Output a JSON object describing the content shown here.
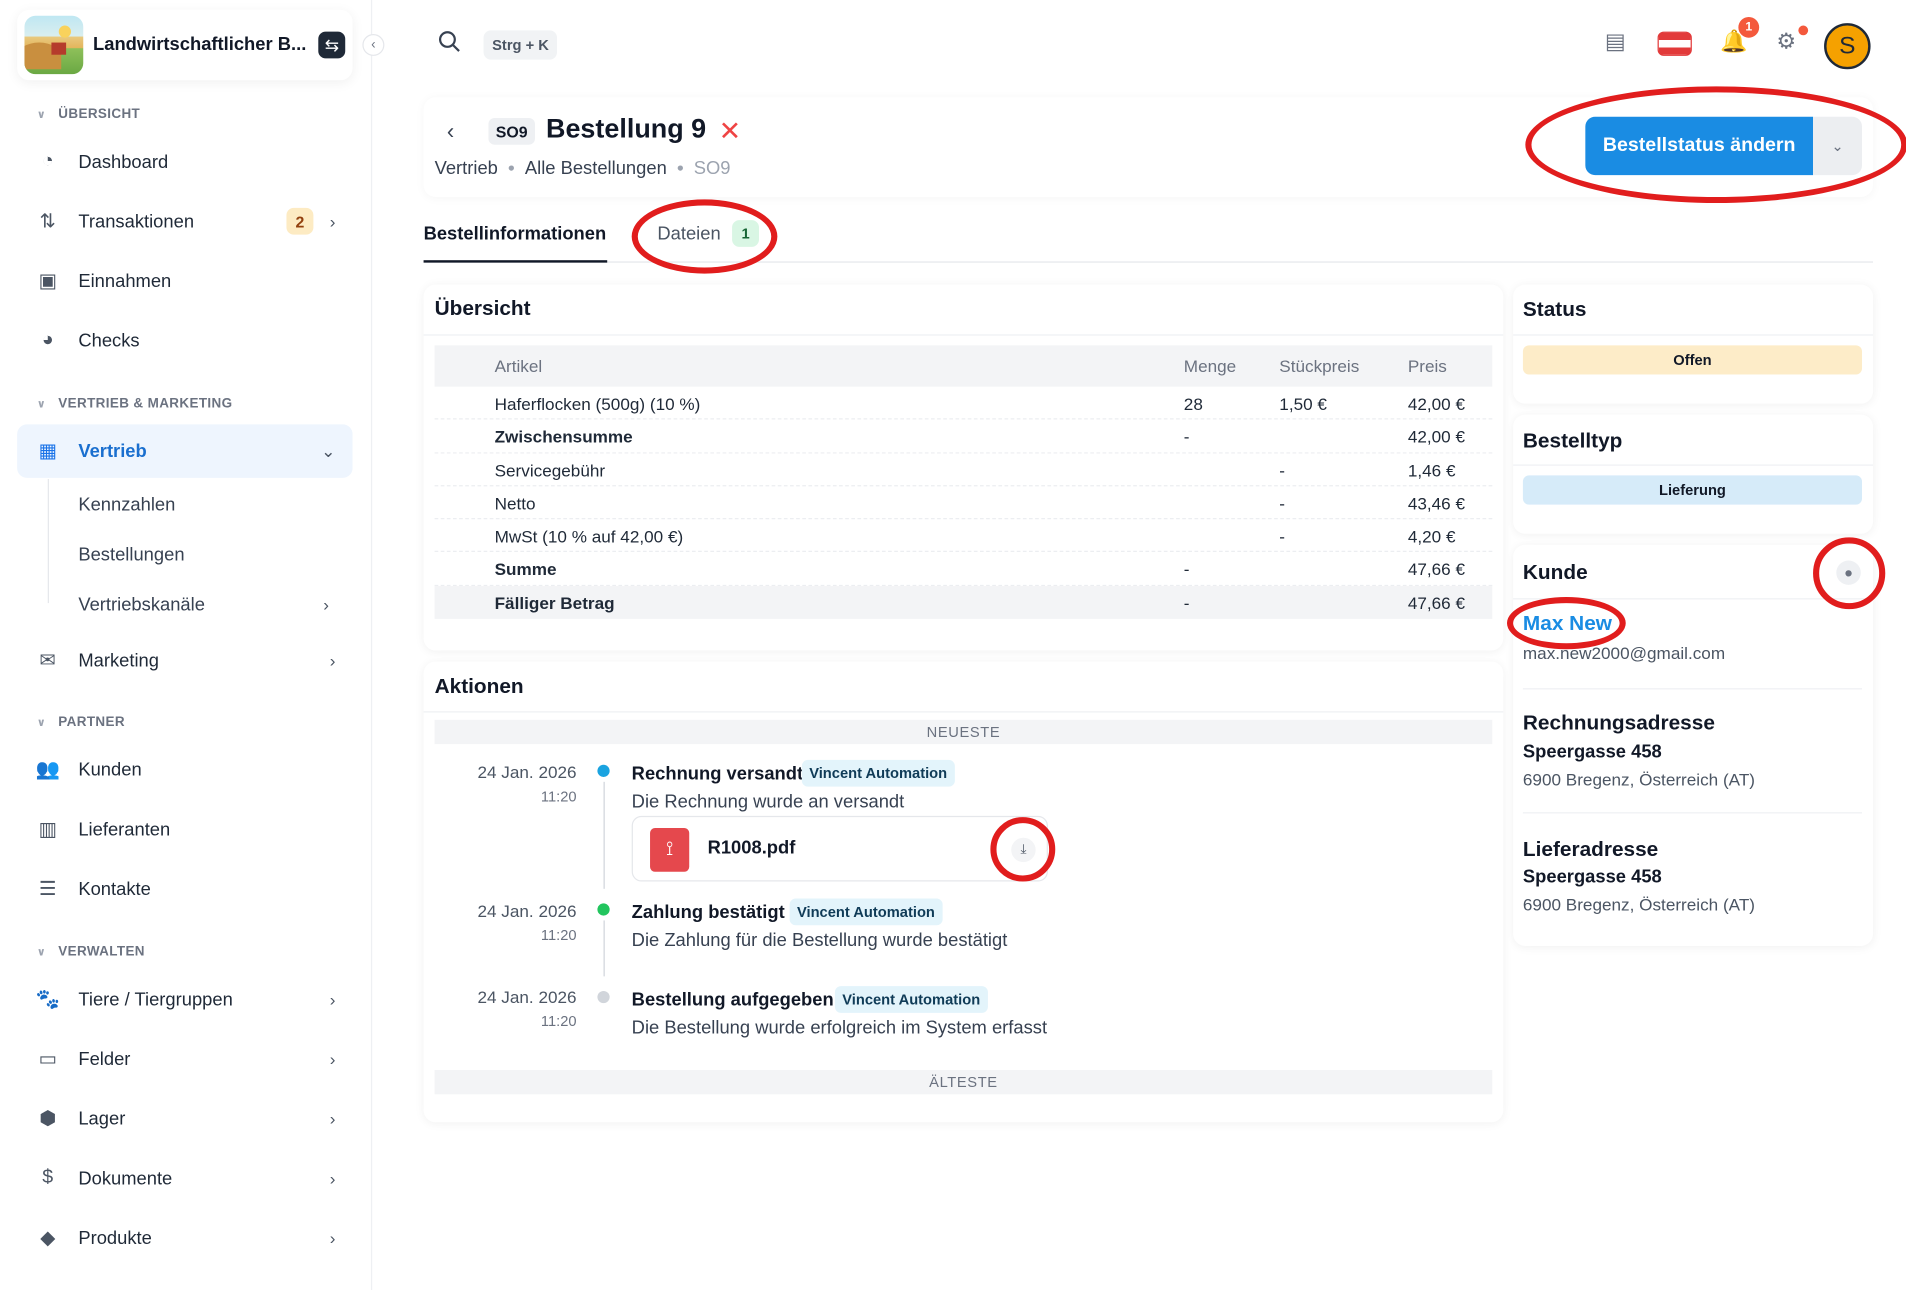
{
  "app": {
    "title": "Landwirtschaftlicher B..."
  },
  "sidebar": {
    "sections": [
      "ÜBERSICHT",
      "VERTRIEB & MARKETING",
      "PARTNER",
      "VERWALTEN"
    ],
    "items": [
      {
        "label": "Dashboard"
      },
      {
        "label": "Transaktionen",
        "badge": "2"
      },
      {
        "label": "Einnahmen"
      },
      {
        "label": "Checks"
      },
      {
        "label": "Vertrieb"
      },
      {
        "label": "Marketing"
      },
      {
        "label": "Kunden"
      },
      {
        "label": "Lieferanten"
      },
      {
        "label": "Kontakte"
      },
      {
        "label": "Tiere / Tiergruppen"
      },
      {
        "label": "Felder"
      },
      {
        "label": "Lager"
      },
      {
        "label": "Dokumente"
      },
      {
        "label": "Produkte"
      }
    ],
    "vertrieb_sub": [
      "Kennzahlen",
      "Bestellungen",
      "Vertriebskanäle"
    ]
  },
  "topbar": {
    "shortcut": "Strg + K",
    "notification_count": "1",
    "avatar_initial": "S"
  },
  "order": {
    "code": "SO9",
    "title": "Bestellung 9",
    "breadcrumb": [
      "Vertrieb",
      "Alle Bestellungen",
      "SO9"
    ],
    "action_button": "Bestellstatus ändern"
  },
  "tabs": [
    {
      "label": "Bestellinformationen"
    },
    {
      "label": "Dateien",
      "badge": "1"
    }
  ],
  "overview": {
    "title": "Übersicht",
    "columns": [
      "Artikel",
      "Menge",
      "Stückpreis",
      "Preis"
    ],
    "rows": [
      {
        "article": "Haferflocken (500g) (10 %)",
        "qty": "28",
        "unit": "1,50 €",
        "price": "42,00 €"
      },
      {
        "article": "Zwischensumme",
        "qty": "-",
        "unit": "",
        "price": "42,00 €"
      },
      {
        "article": "Servicegebühr",
        "qty": "",
        "unit": "-",
        "price": "1,46 €"
      },
      {
        "article": "Netto",
        "qty": "",
        "unit": "-",
        "price": "43,46 €"
      },
      {
        "article": "MwSt (10 % auf 42,00 €)",
        "qty": "",
        "unit": "-",
        "price": "4,20 €"
      },
      {
        "article": "Summe",
        "qty": "-",
        "unit": "",
        "price": "47,66 €"
      },
      {
        "article": "Fälliger Betrag",
        "qty": "-",
        "unit": "",
        "price": "47,66 €"
      }
    ]
  },
  "actions": {
    "title": "Aktionen",
    "newest": "NEUESTE",
    "oldest": "ÄLTESTE",
    "events": [
      {
        "date": "24 Jan. 2026",
        "time": "11:20",
        "title": "Rechnung versandt",
        "tag": "Vincent Automation",
        "desc": "Die Rechnung wurde an versandt",
        "file": "R1008.pdf",
        "color": "#1aa3e0"
      },
      {
        "date": "24 Jan. 2026",
        "time": "11:20",
        "title": "Zahlung bestätigt",
        "tag": "Vincent Automation",
        "desc": "Die Zahlung für die Bestellung wurde bestätigt",
        "color": "#22c55e"
      },
      {
        "date": "24 Jan. 2026",
        "time": "11:20",
        "title": "Bestellung aufgegeben",
        "tag": "Vincent Automation",
        "desc": "Die Bestellung wurde erfolgreich im System erfasst",
        "color": "#d1d5db"
      }
    ]
  },
  "status": {
    "title": "Status",
    "value": "Offen",
    "color": "#fdecc8"
  },
  "order_type": {
    "title": "Bestelltyp",
    "value": "Lieferung",
    "color": "#d6ebf9"
  },
  "customer": {
    "title": "Kunde",
    "name": "Max New",
    "email": "max.new2000@gmail.com",
    "billing_title": "Rechnungsadresse",
    "billing_street": "Speergasse 458",
    "billing_city": "6900 Bregenz, Österreich (AT)",
    "shipping_title": "Lieferadresse",
    "shipping_street": "Speergasse 458",
    "shipping_city": "6900 Bregenz, Österreich (AT)"
  }
}
